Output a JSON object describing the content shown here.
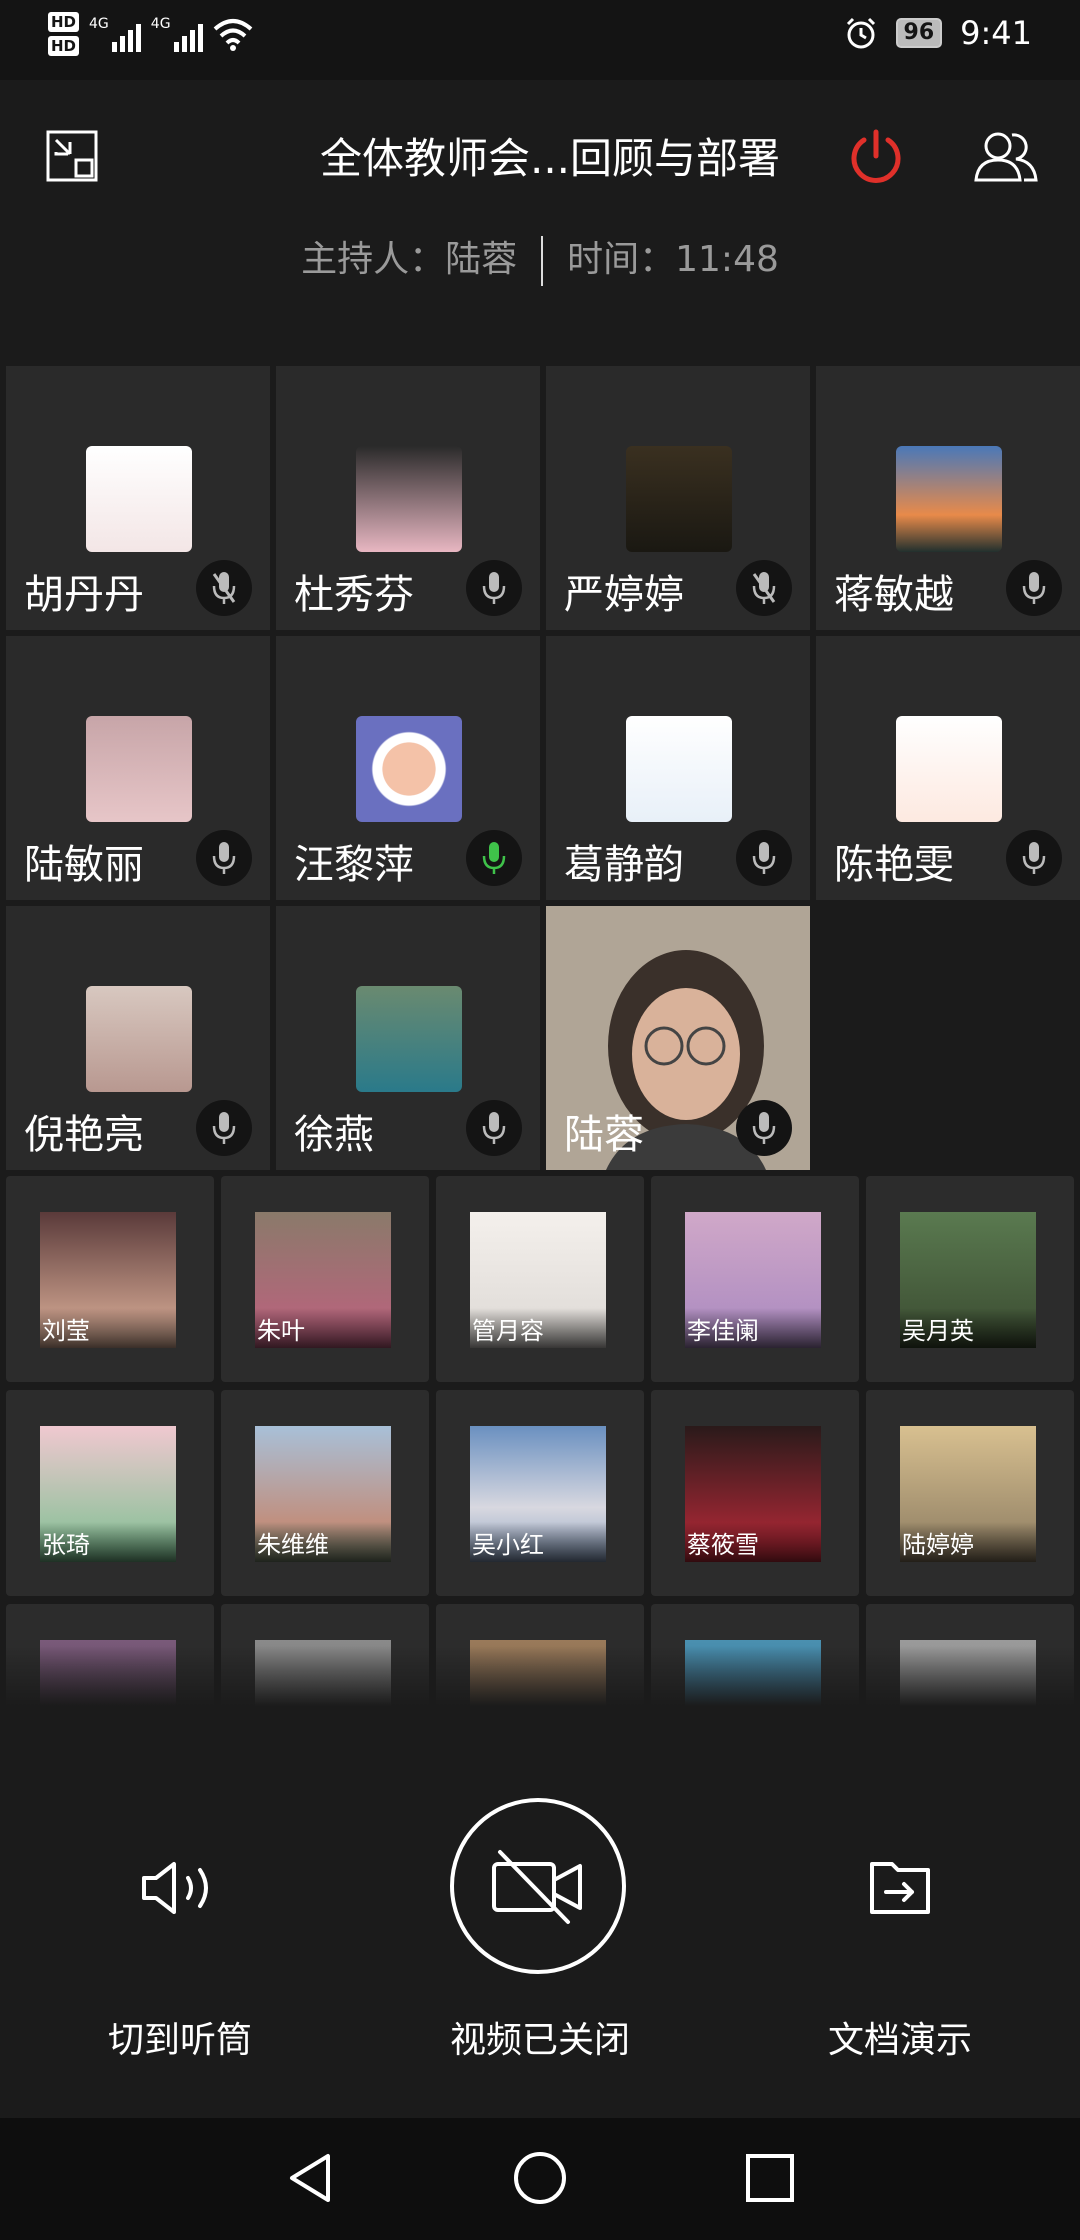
{
  "status_bar": {
    "hd1": "HD",
    "hd2": "HD",
    "net1": "4G",
    "net2": "4G",
    "battery": "96",
    "time": "9:41"
  },
  "header": {
    "title": "全体教师会...回顾与部署",
    "host_label": "主持人：陆蓉",
    "time_label": "时间：11:48",
    "power_color": "#e0302a"
  },
  "participants": [
    {
      "name": "胡丹丹",
      "mic": "muted"
    },
    {
      "name": "杜秀芬",
      "mic": "on"
    },
    {
      "name": "严婷婷",
      "mic": "muted"
    },
    {
      "name": "蒋敏越",
      "mic": "on"
    },
    {
      "name": "陆敏丽",
      "mic": "on"
    },
    {
      "name": "汪黎萍",
      "mic": "speaking"
    },
    {
      "name": "葛静韵",
      "mic": "on"
    },
    {
      "name": "陈艳雯",
      "mic": "on"
    },
    {
      "name": "倪艳亮",
      "mic": "on"
    },
    {
      "name": "徐燕",
      "mic": "on"
    },
    {
      "name": "陆蓉",
      "mic": "on",
      "video": true
    }
  ],
  "small_participants": [
    {
      "name": "刘莹"
    },
    {
      "name": "朱叶"
    },
    {
      "name": "管月容"
    },
    {
      "name": "李佳阑"
    },
    {
      "name": "吴月英"
    },
    {
      "name": "张琦"
    },
    {
      "name": "朱维维"
    },
    {
      "name": "吴小红"
    },
    {
      "name": "蔡筱雪"
    },
    {
      "name": "陆婷婷"
    },
    {
      "name": ""
    },
    {
      "name": ""
    },
    {
      "name": ""
    },
    {
      "name": ""
    },
    {
      "name": ""
    }
  ],
  "controls": {
    "speaker_label": "切到听筒",
    "video_label": "视频已关闭",
    "doc_label": "文档演示"
  }
}
